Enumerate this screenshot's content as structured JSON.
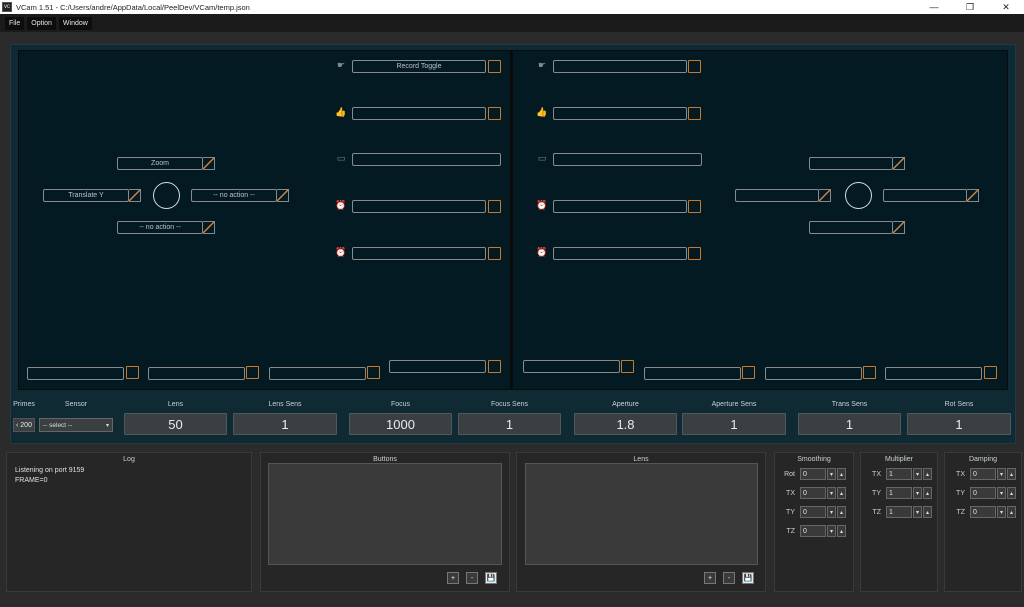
{
  "window": {
    "title": "VCam 1.51 - C:/Users/andre/AppData/Local/PeelDev/VCam/temp.json",
    "app_icon_text": "VC",
    "minimize": "—",
    "maximize": "❐",
    "close": "✕"
  },
  "menu": [
    "File",
    "Option",
    "Window"
  ],
  "left_pad": {
    "up_label": "Zoom",
    "left_label": "Translate Y",
    "right_label": "-- no action --",
    "down_label": "-- no action --"
  },
  "left_buttons": {
    "b1_label": "Record Toggle",
    "b2_label": "",
    "b3_label": "",
    "b4_label": "",
    "b5_label": ""
  },
  "controls": {
    "primes_label": "Primes",
    "primes_value": "‹ 200",
    "sensor_label": "Sensor",
    "sensor_value": "-- select --",
    "lens_label": "Lens",
    "lens_value": "50",
    "lens_sens_label": "Lens Sens",
    "lens_sens_value": "1",
    "focus_label": "Focus",
    "focus_value": "1000",
    "focus_sens_label": "Focus Sens",
    "focus_sens_value": "1",
    "aperture_label": "Aperture",
    "aperture_value": "1.8",
    "aperture_sens_label": "Aperture Sens",
    "aperture_sens_value": "1",
    "trans_sens_label": "Trans Sens",
    "trans_sens_value": "1",
    "rot_sens_label": "Rot Sens",
    "rot_sens_value": "1"
  },
  "log": {
    "title": "Log",
    "text": "Listening on port 9159\nFRAME=0"
  },
  "buttons_panel": {
    "title": "Buttons",
    "add": "+",
    "remove": "-",
    "save": "💾"
  },
  "lens_panel": {
    "title": "Lens",
    "add": "+",
    "remove": "-",
    "save": "💾"
  },
  "smoothing": {
    "title": "Smoothing",
    "rows": [
      {
        "label": "Rot",
        "value": "0"
      },
      {
        "label": "TX",
        "value": "0"
      },
      {
        "label": "TY",
        "value": "0"
      },
      {
        "label": "TZ",
        "value": "0"
      }
    ]
  },
  "multiplier": {
    "title": "Multiplier",
    "rows": [
      {
        "label": "TX",
        "value": "1"
      },
      {
        "label": "TY",
        "value": "1"
      },
      {
        "label": "TZ",
        "value": "1"
      }
    ]
  },
  "damping": {
    "title": "Damping",
    "rows": [
      {
        "label": "TX",
        "value": "0"
      },
      {
        "label": "TY",
        "value": "0"
      },
      {
        "label": "TZ",
        "value": "0"
      }
    ]
  },
  "spinner": {
    "up": "▴",
    "down": "▾"
  },
  "icons": {
    "point": "☛",
    "thumb": "👍",
    "grip": "▭",
    "alarm": "⏰"
  }
}
